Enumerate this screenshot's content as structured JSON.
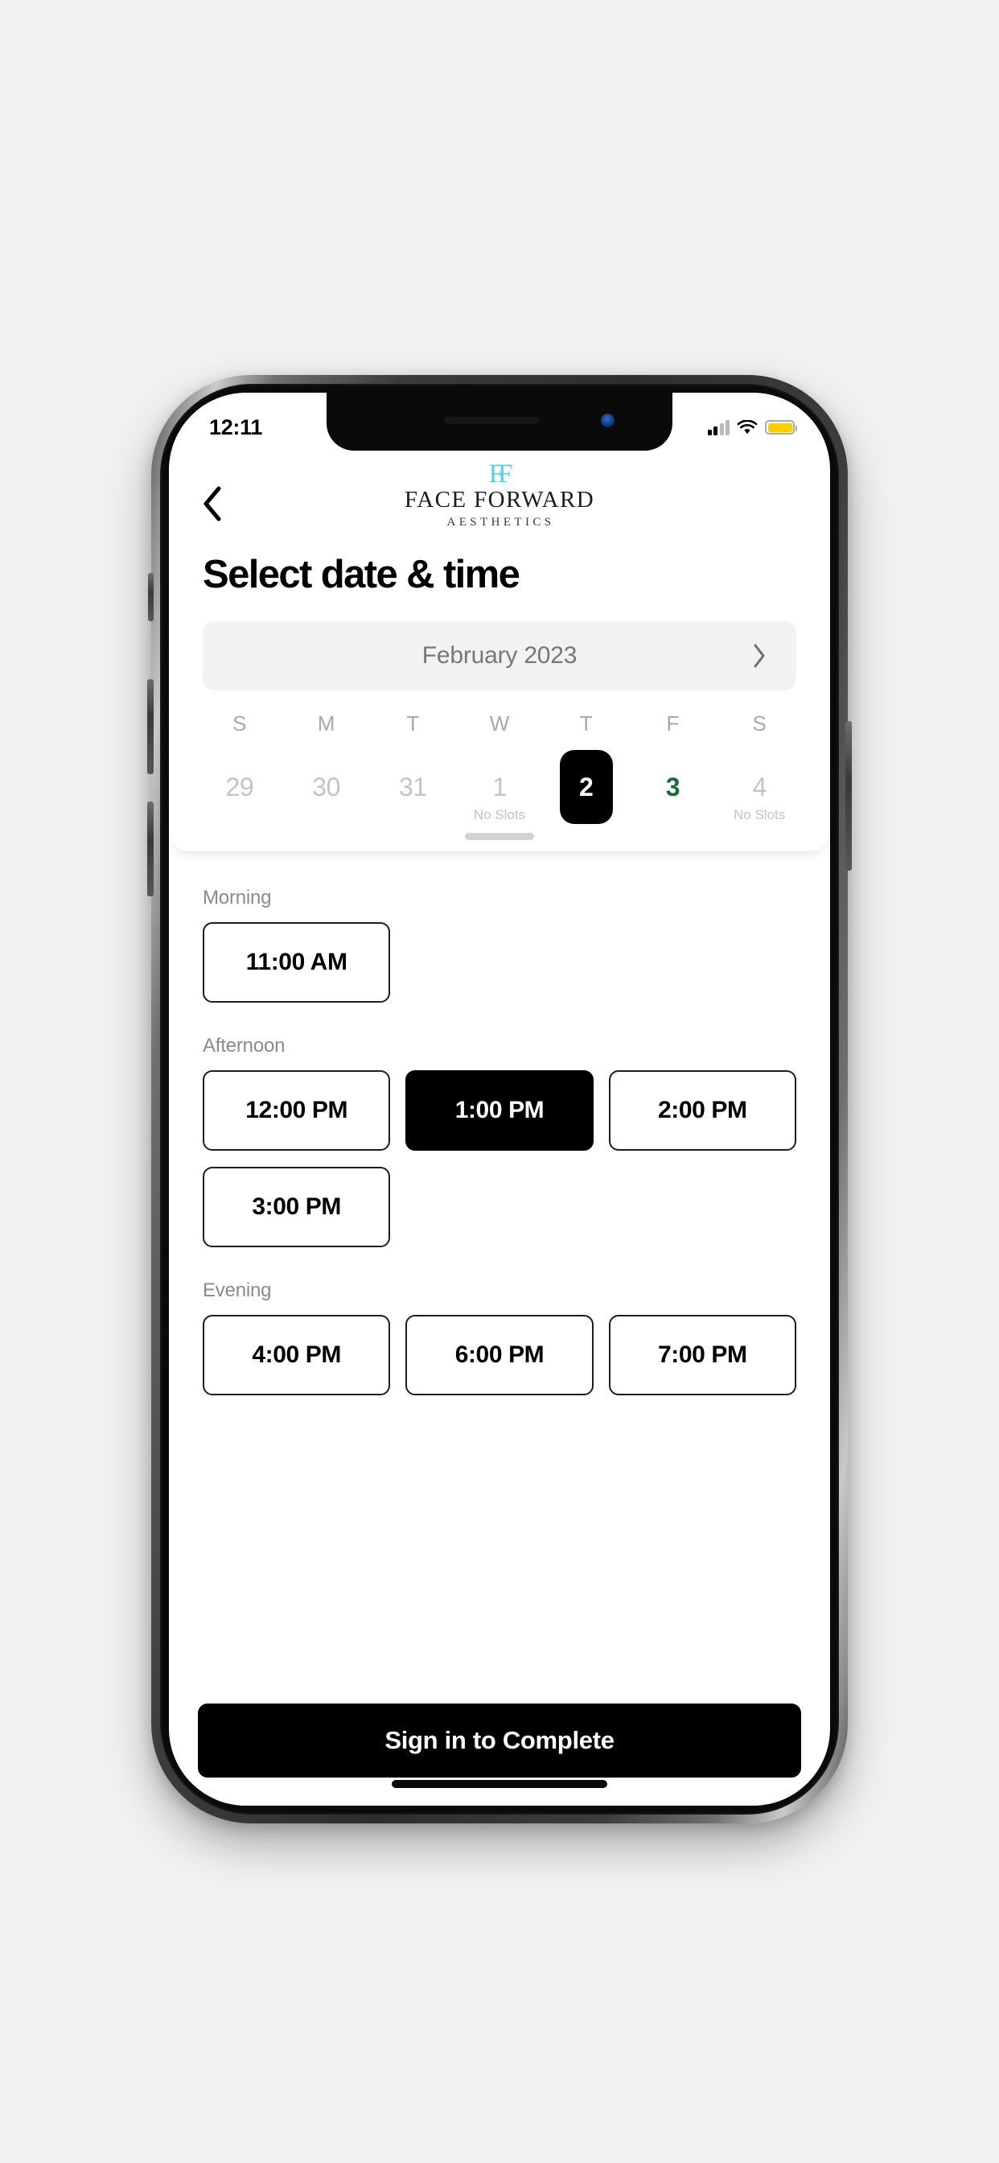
{
  "status_bar": {
    "time": "12:11",
    "signal_icon": "cellular-signal-icon",
    "wifi_icon": "wifi-icon",
    "battery_icon": "battery-icon",
    "battery_color": "#ffcc00"
  },
  "appbar": {
    "back_icon": "chevron-left-icon",
    "logo": {
      "monogram": "FF",
      "monogram_color": "#4fd2ea",
      "name": "FACE FORWARD",
      "subtitle": "AESTHETICS"
    }
  },
  "page": {
    "title": "Select date & time"
  },
  "calendar": {
    "month_label": "February 2023",
    "next_icon": "chevron-right-icon",
    "weekdays": [
      "S",
      "M",
      "T",
      "W",
      "T",
      "F",
      "S"
    ],
    "days": [
      {
        "num": "29",
        "note": "",
        "state": "disabled"
      },
      {
        "num": "30",
        "note": "",
        "state": "disabled"
      },
      {
        "num": "31",
        "note": "",
        "state": "disabled"
      },
      {
        "num": "1",
        "note": "No Slots",
        "state": "disabled"
      },
      {
        "num": "2",
        "note": "",
        "state": "selected"
      },
      {
        "num": "3",
        "note": "",
        "state": "available"
      },
      {
        "num": "4",
        "note": "No Slots",
        "state": "disabled"
      }
    ],
    "available_color": "#1b6b3a",
    "drag_handle": "calendar-drag-handle"
  },
  "slot_groups": [
    {
      "label": "Morning",
      "slots": [
        {
          "time": "11:00 AM",
          "selected": false
        }
      ]
    },
    {
      "label": "Afternoon",
      "slots": [
        {
          "time": "12:00 PM",
          "selected": false
        },
        {
          "time": "1:00 PM",
          "selected": true
        },
        {
          "time": "2:00 PM",
          "selected": false
        },
        {
          "time": "3:00 PM",
          "selected": false
        }
      ]
    },
    {
      "label": "Evening",
      "slots": [
        {
          "time": "4:00 PM",
          "selected": false
        },
        {
          "time": "6:00 PM",
          "selected": false
        },
        {
          "time": "7:00 PM",
          "selected": false
        }
      ]
    }
  ],
  "cta": {
    "label": "Sign in to Complete"
  }
}
